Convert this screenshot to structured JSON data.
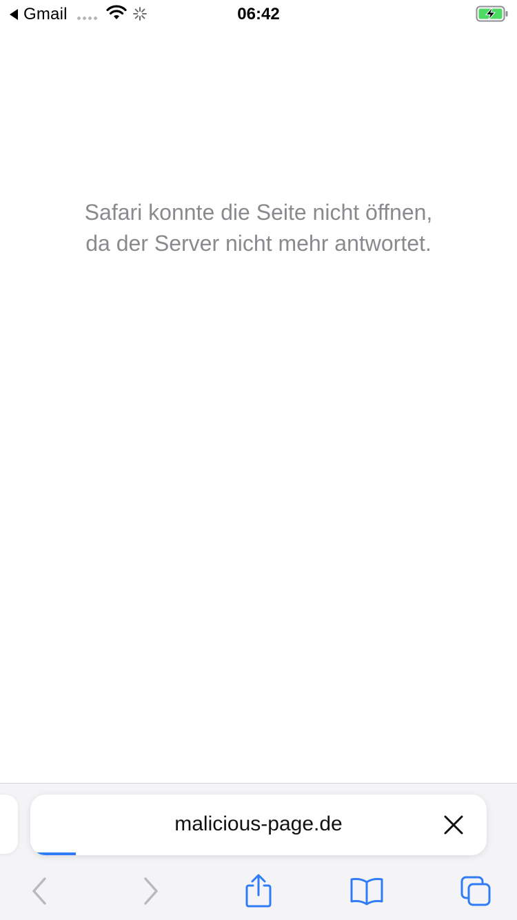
{
  "status_bar": {
    "back_app": "Gmail",
    "time": "06:42"
  },
  "page": {
    "error_line1": "Safari konnte die Seite nicht öffnen,",
    "error_line2": "da der Server nicht mehr antwortet."
  },
  "address_bar": {
    "url": "malicious-page.de",
    "loading_progress": 0.1
  },
  "toolbar": {
    "back_icon": "chevron-left-icon",
    "forward_icon": "chevron-right-icon",
    "share_icon": "share-icon",
    "bookmarks_icon": "book-icon",
    "tabs_icon": "tabs-icon"
  },
  "colors": {
    "accent": "#2f7cf6",
    "disabled": "#b9b9bd",
    "message": "#8a8a8e",
    "battery_green": "#4cd964"
  }
}
